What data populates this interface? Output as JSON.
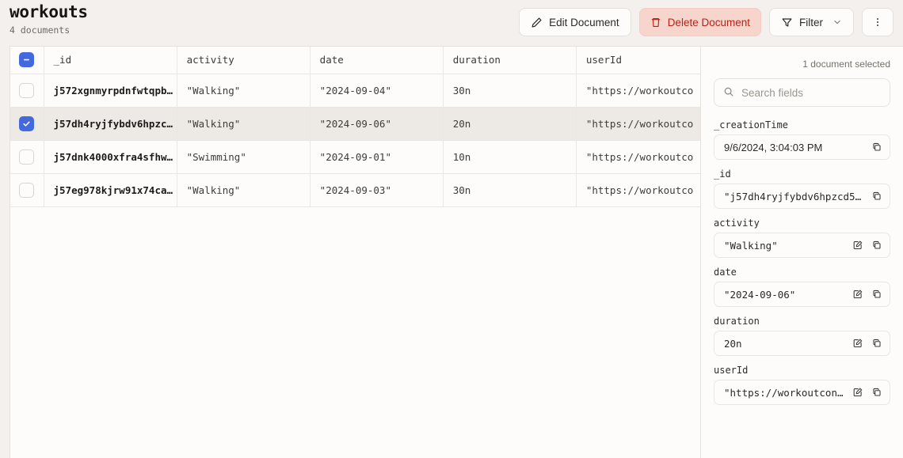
{
  "header": {
    "title": "workouts",
    "doc_count": "4 documents",
    "buttons": {
      "edit": "Edit Document",
      "delete": "Delete Document",
      "filter": "Filter"
    }
  },
  "table": {
    "columns": [
      "_id",
      "activity",
      "date",
      "duration",
      "userId"
    ],
    "header_checkbox_state": "indeterminate",
    "rows": [
      {
        "selected": false,
        "_id": "j572xgnmyrpdnfwtqpb…",
        "activity": "\"Walking\"",
        "date": "\"2024-09-04\"",
        "duration": "30n",
        "userId": "\"https://workoutco"
      },
      {
        "selected": true,
        "_id": "j57dh4ryjfybdv6hpzc…",
        "activity": "\"Walking\"",
        "date": "\"2024-09-06\"",
        "duration": "20n",
        "userId": "\"https://workoutco"
      },
      {
        "selected": false,
        "_id": "j57dnk4000xfra4sfhw…",
        "activity": "\"Swimming\"",
        "date": "\"2024-09-01\"",
        "duration": "10n",
        "userId": "\"https://workoutco"
      },
      {
        "selected": false,
        "_id": "j57eg978kjrw91x74ca…",
        "activity": "\"Walking\"",
        "date": "\"2024-09-03\"",
        "duration": "30n",
        "userId": "\"https://workoutco"
      }
    ]
  },
  "panel": {
    "status": "1 document selected",
    "search_placeholder": "Search fields",
    "search_value": "",
    "fields": [
      {
        "label": "_creationTime",
        "value": "9/6/2024, 3:04:03 PM",
        "mono": false,
        "editable": false
      },
      {
        "label": "_id",
        "value": "\"j57dh4ryjfybdv6hpzcd5cd…",
        "mono": true,
        "editable": false
      },
      {
        "label": "activity",
        "value": "\"Walking\"",
        "mono": true,
        "editable": true
      },
      {
        "label": "date",
        "value": "\"2024-09-06\"",
        "mono": true,
        "editable": true
      },
      {
        "label": "duration",
        "value": "20n",
        "mono": true,
        "editable": true
      },
      {
        "label": "userId",
        "value": "\"https://workoutconv…",
        "mono": true,
        "editable": true
      }
    ]
  },
  "colors": {
    "accent_blue": "#4468dd",
    "danger_bg": "#f7d5cd",
    "danger_fg": "#b42318",
    "page_bg": "#f3f0ee",
    "surface": "#fdfcfb"
  }
}
